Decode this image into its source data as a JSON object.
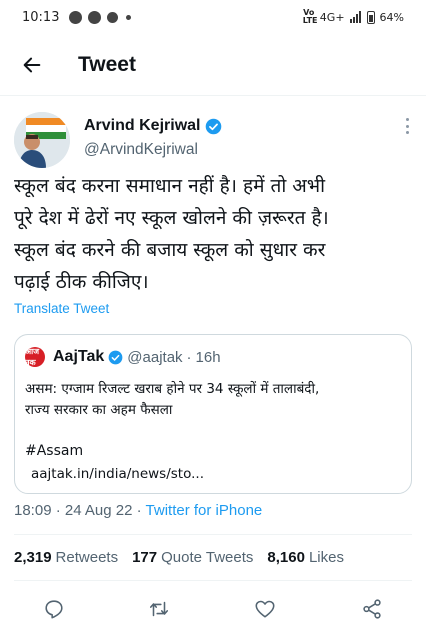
{
  "status_bar": {
    "time": "10:13",
    "network": "4G+",
    "volte": "Vo LTE",
    "battery": "64%"
  },
  "header": {
    "title": "Tweet"
  },
  "tweet": {
    "author_name": "Arvind Kejriwal",
    "author_handle": "@ArvindKejriwal",
    "text_lines": [
      "स्कूल बंद करना समाधान नहीं है। हमें तो अभी",
      "पूरे देश में ढेरों नए स्कूल खोलने की ज़रूरत है।",
      "स्कूल बंद करने की बजाय स्कूल को सुधार कर",
      "पढ़ाई ठीक कीजिए।"
    ],
    "translate_label": "Translate Tweet",
    "time": "18:09",
    "date": "24 Aug 22",
    "source": "Twitter for iPhone",
    "sep": "·"
  },
  "quote": {
    "logo_text": "आज तक",
    "name": "AajTak",
    "handle": "@aajtak",
    "age": "16h",
    "sep": "·",
    "text_lines": [
      "असम: एग्जाम रिजल्ट खराब होने पर 34 स्कूलों में तालाबंदी,",
      "राज्य सरकार का अहम फैसला"
    ],
    "hashtag": "#Assam",
    "link": "aajtak.in/india/news/sto..."
  },
  "stats": {
    "retweets_count": "2,319",
    "retweets_label": "Retweets",
    "quotes_count": "177",
    "quotes_label": "Quote Tweets",
    "likes_count": "8,160",
    "likes_label": "Likes"
  },
  "icons": {
    "back": "arrow-left-icon",
    "verified": "verified-badge-icon",
    "more": "more-vertical-icon",
    "reply": "reply-icon",
    "retweet": "retweet-icon",
    "like": "heart-icon",
    "share": "share-icon"
  },
  "colors": {
    "accent": "#1d9bf0",
    "text": "#0f1419",
    "muted": "#536471",
    "aajtak_red": "#d71f26"
  }
}
